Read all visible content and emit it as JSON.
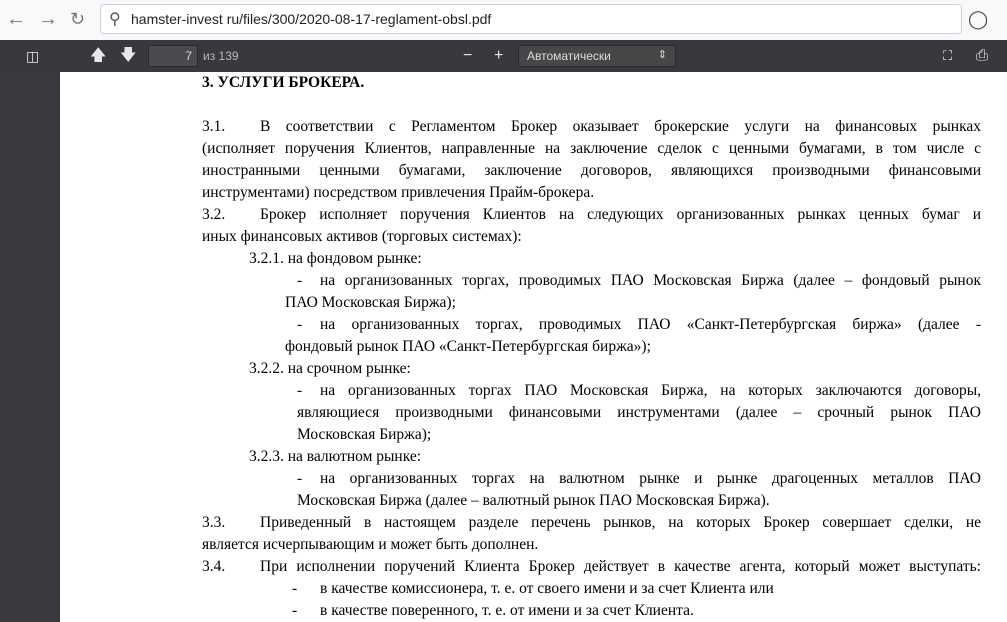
{
  "browser": {
    "url": "hamster-invest ru/files/300/2020-08-17-reglament-obsl.pdf"
  },
  "toolbar": {
    "page": "7",
    "of": "из 139",
    "zoom": "Автоматически"
  },
  "doc": {
    "heading": "3. УСЛУГИ БРОКЕРА.",
    "lines": [
      {
        "kind": "num",
        "label": "3.1.",
        "text": "В соответствии с Регламентом Брокер оказывает брокерские услуги на финансовых рынках",
        "j": true
      },
      {
        "kind": "cont",
        "text": "(исполняет поручения Клиентов, направленные на заключение сделок с ценными бумагами, в том числе с",
        "j": true
      },
      {
        "kind": "cont",
        "text": "иностранными ценными бумагами, заключение договоров, являющихся производными финансовыми",
        "j": true
      },
      {
        "kind": "cont",
        "text": "инструментами) посредством привлечения Прайм-брокера.",
        "j": false
      },
      {
        "kind": "num",
        "label": "3.2.",
        "text": "Брокер исполняет поручения Клиентов на следующих организованных рынках ценных бумаг и",
        "j": true
      },
      {
        "kind": "cont",
        "text": "иных финансовых активов (торговых системах):",
        "j": false
      },
      {
        "kind": "sub",
        "text": "3.2.1. на фондовом рынке:",
        "j": false
      },
      {
        "kind": "dash",
        "label": "-",
        "text": "на организованных торгах, проводимых ПАО Московская Биржа (далее – фондовый рынок",
        "j": true
      },
      {
        "kind": "dc1",
        "text": "ПАО Московская Биржа);",
        "j": false
      },
      {
        "kind": "dash",
        "label": "-",
        "text": "на организованных торгах, проводимых ПАО «Санкт-Петербургская биржа» (далее -",
        "j": true
      },
      {
        "kind": "dc1",
        "text": "фондовый рынок ПАО «Санкт-Петербургская биржа»);",
        "j": false
      },
      {
        "kind": "sub",
        "text": "3.2.2. на срочном рынке:",
        "j": false
      },
      {
        "kind": "dash",
        "label": "-",
        "text": "на организованных торгах ПАО Московская Биржа, на которых заключаются договоры,",
        "j": true
      },
      {
        "kind": "dc2",
        "text": "являющиеся производными финансовыми инструментами (далее – срочный рынок ПАО",
        "j": true
      },
      {
        "kind": "dc2",
        "text": "Московская Биржа);",
        "j": false
      },
      {
        "kind": "sub",
        "text": "3.2.3. на валютном рынке:",
        "j": false
      },
      {
        "kind": "dash",
        "label": "-",
        "text": "на организованных торгах на валютном рынке и рынке драгоценных металлов ПАО",
        "j": true
      },
      {
        "kind": "dc2",
        "text": "Московская Биржа (далее – валютный рынок ПАО Московская Биржа).",
        "j": false
      },
      {
        "kind": "num",
        "label": "3.3.",
        "text": "Приведенный в настоящем разделе перечень рынков, на которых Брокер совершает сделки, не",
        "j": true
      },
      {
        "kind": "cont",
        "text": "является исчерпывающим и может быть дополнен.",
        "j": false
      },
      {
        "kind": "num",
        "label": "3.4.",
        "text": "При исполнении поручений Клиента Брокер действует в качестве агента, который может выступать:",
        "j": true
      },
      {
        "kind": "dash2",
        "label": "-",
        "text": "в качестве комиссионера, т. е. от своего имени и за счет Клиента или",
        "j": false
      },
      {
        "kind": "dash2",
        "label": "-",
        "text": "в качестве поверенного, т. е. от имени и за счет Клиента.",
        "j": false
      }
    ]
  }
}
